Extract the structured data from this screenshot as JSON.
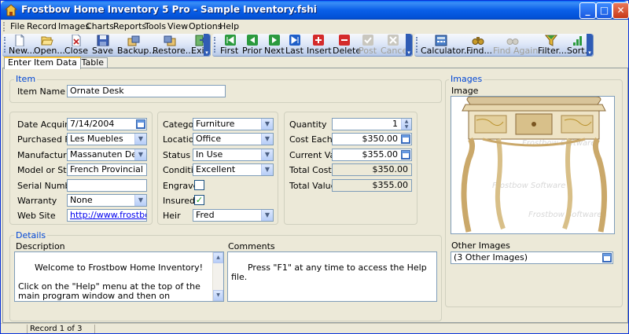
{
  "window": {
    "title": "Frostbow Home Inventory 5 Pro - Sample Inventory.fshi"
  },
  "menu": [
    "File",
    "Record",
    "Images",
    "Charts",
    "Reports",
    "Tools",
    "View",
    "Options",
    "Help"
  ],
  "toolbar": {
    "new": "New...",
    "open": "Open...",
    "close": "Close",
    "save": "Save",
    "backup": "Backup...",
    "restore": "Restore...",
    "exit": "Exit",
    "first": "First",
    "prior": "Prior",
    "next": "Next",
    "last": "Last",
    "insert": "Insert",
    "delete": "Delete",
    "post": "Post",
    "cancel": "Cancel",
    "calculator": "Calculator...",
    "find": "Find...",
    "find_again": "Find Again...",
    "filter": "Filter...",
    "sort": "Sort..."
  },
  "tabs": [
    "Enter Item Data",
    "View Table"
  ],
  "item_group": {
    "title": "Item",
    "item_name_label": "Item Name",
    "item_name": "Ornate Desk"
  },
  "col1": {
    "date_acquired_label": "Date Acquired",
    "date_acquired": "7/14/2004",
    "purchased_from_label": "Purchased From",
    "purchased_from": "Les Muebles",
    "manufacturer_label": "Manufacturer",
    "manufacturer": "Massanuten Desks",
    "model_label": "Model or Style",
    "model": "French Provincial",
    "serial_label": "Serial Number",
    "serial": "",
    "warranty_label": "Warranty",
    "warranty": "None",
    "website_label": "Web Site",
    "website": "http://www.frostbow.com"
  },
  "col2": {
    "category_label": "Category",
    "category": "Furniture",
    "location_label": "Location",
    "location": "Office",
    "status_label": "Status",
    "status": "In Use",
    "condition_label": "Condition",
    "condition": "Excellent",
    "engraved_label": "Engraved",
    "engraved": false,
    "insured_label": "Insured",
    "insured": true,
    "heir_label": "Heir",
    "heir": "Fred"
  },
  "col3": {
    "quantity_label": "Quantity",
    "quantity": "1",
    "cost_each_label": "Cost Each",
    "cost_each": "$350.00",
    "current_value_label": "Current Value",
    "current_value": "$355.00",
    "total_cost_label": "Total Cost",
    "total_cost": "$350.00",
    "total_value_label": "Total Value",
    "total_value": "$355.00"
  },
  "details": {
    "title": "Details",
    "description_label": "Description",
    "description": "Welcome to Frostbow Home Inventory!\n\nClick on the \"Help\" menu at the top of the main program window and then on \"Contents...\" to display the online help file.  Check out the \"Getting Started\" section for instructions on how to start using Frostbow Home Inventory.",
    "comments_label": "Comments",
    "comments": "Press \"F1\" at any time to access the Help file."
  },
  "images": {
    "title": "Images",
    "image_label": "Image",
    "watermark": "Frostbow Software",
    "other_label": "Other Images",
    "other_value": "(3 Other Images)"
  },
  "status": {
    "record": "Record 1 of 3"
  }
}
